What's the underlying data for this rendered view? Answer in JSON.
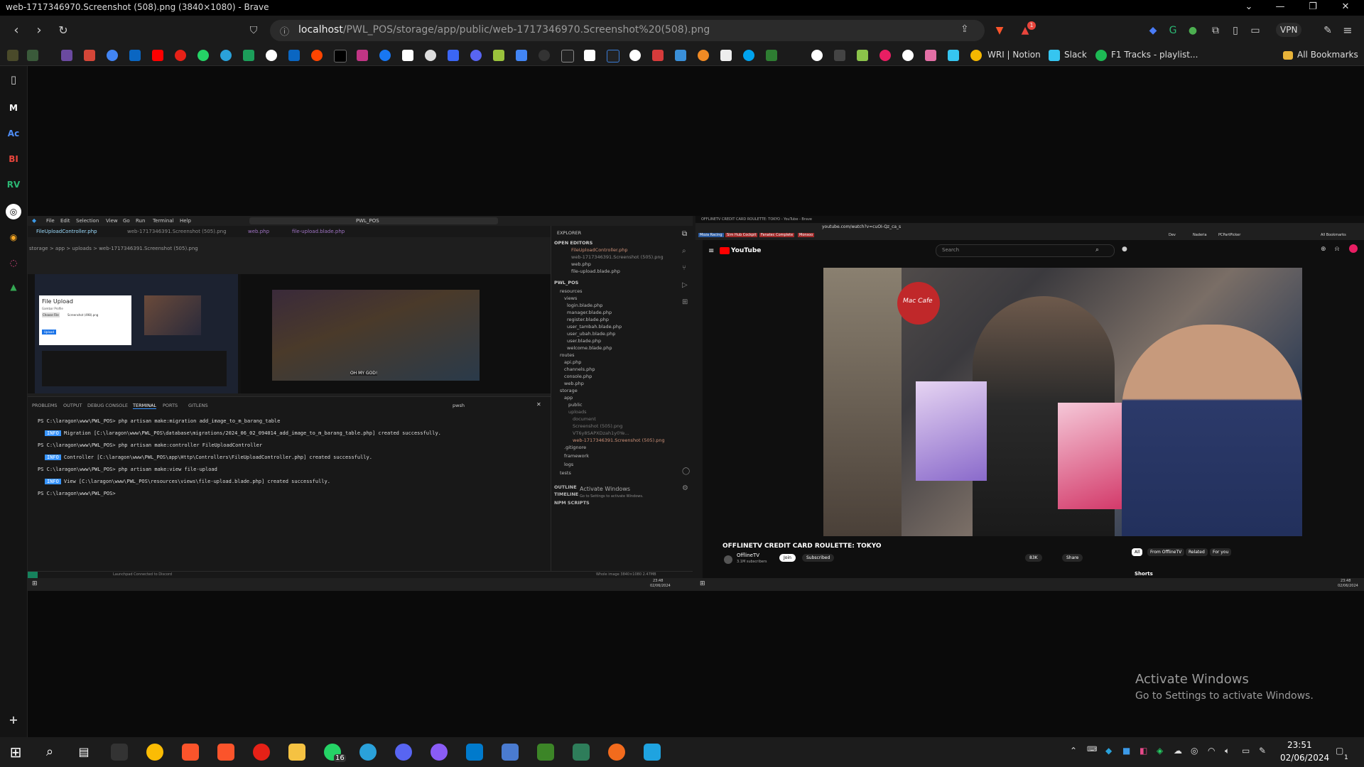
{
  "window": {
    "title": "web-1717346970.Screenshot (508).png (3840×1080) - Brave"
  },
  "browser": {
    "url_host": "localhost",
    "url_path": "/PWL_POS/storage/app/public/web-1717346970.Screenshot%20(508).png",
    "vpn_label": "VPN",
    "shield_count": "1",
    "bookmarks": [
      {
        "label": "WRI | Notion"
      },
      {
        "label": "Slack"
      },
      {
        "label": "F1 Tracks - playlist..."
      }
    ],
    "all_bookmarks": "All Bookmarks"
  },
  "sidebar": {
    "items": [
      "M",
      "Ac",
      "BI",
      "RV"
    ]
  },
  "vscode": {
    "menu": [
      "File",
      "Edit",
      "Selection",
      "View",
      "Go",
      "Run",
      "Terminal",
      "Help"
    ],
    "search": "PWL_POS",
    "tabs": [
      "FileUploadController.php",
      "web-1717346391.Screenshot (505).png",
      "web.php",
      "file-upload.blade.php"
    ],
    "breadcrumb": "storage > app > uploads > web-1717346391.Screenshot (505).png",
    "preview": {
      "file_upload_title": "File Upload",
      "gambar_profile": "Gambar Profile",
      "choose_file": "Choose File",
      "file_name": "Screenshot (498).png",
      "upload_btn": "Upload",
      "subtitle": "OH MY GOD!"
    },
    "panel_tabs": [
      "PROBLEMS",
      "OUTPUT",
      "DEBUG CONSOLE",
      "TERMINAL",
      "PORTS",
      "GITLENS"
    ],
    "shell_label": "pwsh",
    "terminal": {
      "l1": "PS C:\\laragon\\www\\PWL_POS> php artisan make:migration add_image_to_m_barang_table",
      "l2_info": "INFO",
      "l2": "Migration [C:\\laragon\\www\\PWL_POS\\database\\migrations/2024_06_02_094014_add_image_to_m_barang_table.php] created successfully.",
      "l3": "PS C:\\laragon\\www\\PWL_POS> php artisan make:controller FileUploadController",
      "l4": "Controller [C:\\laragon\\www\\PWL_POS\\app\\Http\\Controllers\\FileUploadController.php] created successfully.",
      "l5": "PS C:\\laragon\\www\\PWL_POS> php artisan make:view file-upload",
      "l6": "View [C:\\laragon\\www\\PWL_POS\\resources\\views\\file-upload.blade.php] created successfully.",
      "l7": "PS C:\\laragon\\www\\PWL_POS>"
    },
    "explorer": {
      "header": "EXPLORER",
      "open_editors": "OPEN EDITORS",
      "open_files": [
        "FileUploadController.php",
        "web-1717346391.Screenshot (505).png",
        "web.php",
        "file-upload.blade.php"
      ],
      "project": "PWL_POS",
      "tree": [
        "resources",
        "views",
        "login.blade.php",
        "manager.blade.php",
        "register.blade.php",
        "user_tambah.blade.php",
        "user_ubah.blade.php",
        "user.blade.php",
        "welcome.blade.php",
        "routes",
        "api.php",
        "channels.php",
        "console.php",
        "web.php",
        "storage",
        "app",
        "public",
        "uploads",
        "document",
        "Screenshot (505).png",
        "VT6y8SAPXDzah1y0Ye...",
        "web-1717346391.Screenshot (505).png",
        ".gitignore",
        "framework",
        "logs",
        "tests"
      ],
      "outline": "OUTLINE",
      "timeline": "TIMELINE",
      "npm": "NPM SCRIPTS"
    },
    "activate": "Activate Windows",
    "activate_sub": "Go to Settings to activate Windows.",
    "statusbar": "Launchpad   Connected to Discord",
    "status_right": "Whole image   3840×1080   2.47MB",
    "taskbar_time": "23:48",
    "taskbar_date": "02/06/2024"
  },
  "youtube": {
    "tab_title": "OFFLINETV CREDIT CARD ROULETTE: TOKYO - YouTube - Brave",
    "url": "youtube.com/watch?v=cuOI-Qz_ca_s",
    "bookmarks": [
      "Moza Racing",
      "Sim Hub Cockpit",
      "Fanatec Complete",
      "Monsoo"
    ],
    "right_bookmarks": [
      "Dev",
      "Naderia",
      "PCPartPicker",
      "All Bookmarks"
    ],
    "logo": "YouTube",
    "search_placeholder": "Search",
    "video_title": "OFFLINETV CREDIT CARD ROULETTE: TOKYO",
    "channel": "OfflineTV",
    "subscribers": "3.1M subscribers",
    "join": "Join",
    "subscribed": "Subscribed",
    "likes": "83K",
    "share": "Share",
    "chips": [
      "All",
      "From OfflineTV",
      "Related",
      "For you"
    ],
    "shorts": "Shorts",
    "sign_text": "Mac Cafe",
    "time": "23:48",
    "date": "02/06/2024"
  },
  "activation": {
    "title": "Activate Windows",
    "subtitle": "Go to Settings to activate Windows."
  },
  "taskbar": {
    "whatsapp_badge": "16",
    "time": "23:51",
    "date": "02/06/2024",
    "notif": "1"
  }
}
